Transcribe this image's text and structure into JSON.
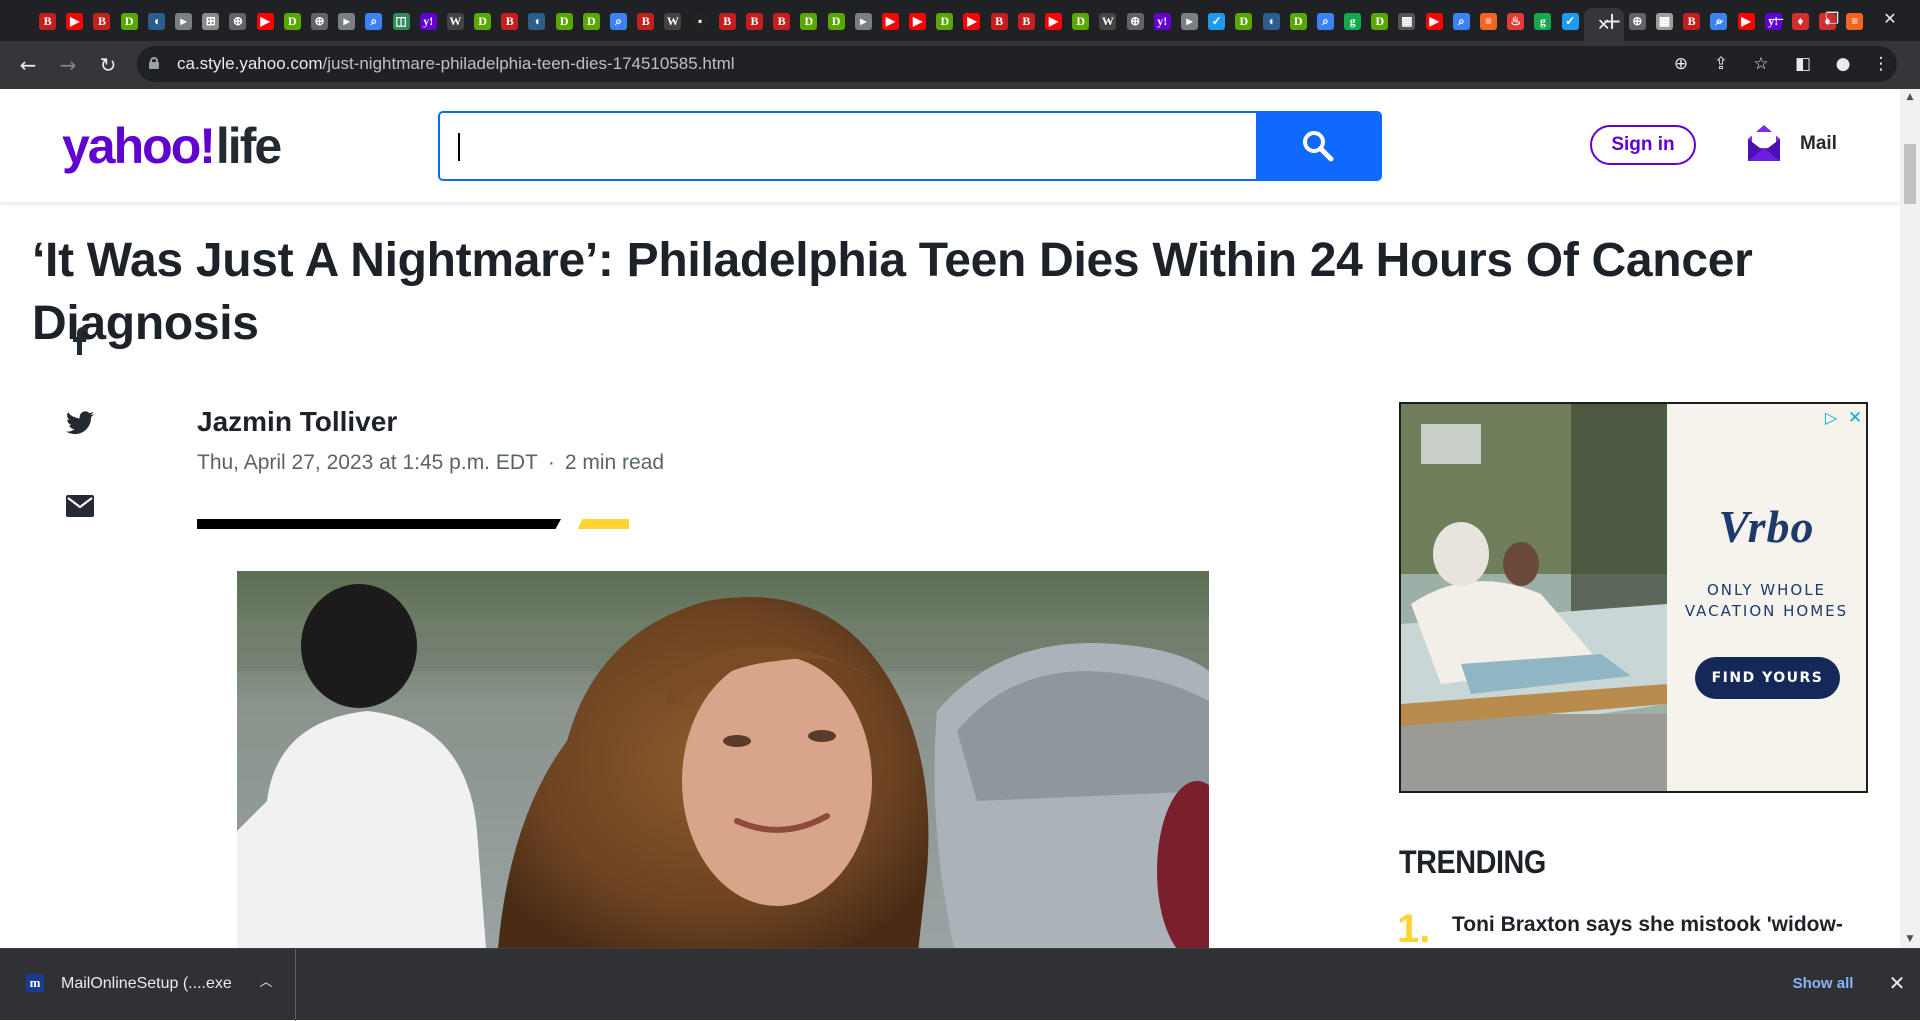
{
  "browser": {
    "tabs": [
      {
        "icon": "B",
        "color": "#c41e1e"
      },
      {
        "icon": "▶",
        "color": "#ff0000"
      },
      {
        "icon": "B",
        "color": "#c41e1e"
      },
      {
        "icon": "D",
        "color": "#5aa700"
      },
      {
        "icon": "◖",
        "color": "#2d5d8a"
      },
      {
        "icon": "▸",
        "color": "#7a7f86"
      },
      {
        "icon": "⊞",
        "color": "#8b8b8b"
      },
      {
        "icon": "⊕",
        "color": "#606368"
      },
      {
        "icon": "▶",
        "color": "#ff0000"
      },
      {
        "icon": "D",
        "color": "#5aa700"
      },
      {
        "icon": "⊕",
        "color": "#606368"
      },
      {
        "icon": "▸",
        "color": "#7a7f86"
      },
      {
        "icon": "⌕",
        "color": "#3b82f6"
      },
      {
        "icon": "◫",
        "color": "#2e8b57"
      },
      {
        "icon": "y!",
        "color": "#6001d2"
      },
      {
        "icon": "W",
        "color": "#444"
      },
      {
        "icon": "D",
        "color": "#5aa700"
      },
      {
        "icon": "B",
        "color": "#c41e1e"
      },
      {
        "icon": "◖",
        "color": "#2d5d8a"
      },
      {
        "icon": "D",
        "color": "#5aa700"
      },
      {
        "icon": "D",
        "color": "#5aa700"
      },
      {
        "icon": "⌕",
        "color": "#3b82f6"
      },
      {
        "icon": "B",
        "color": "#c41e1e"
      },
      {
        "icon": "W",
        "color": "#444"
      },
      {
        "icon": "▪",
        "color": "#222"
      },
      {
        "icon": "B",
        "color": "#c41e1e"
      },
      {
        "icon": "B",
        "color": "#c41e1e"
      },
      {
        "icon": "B",
        "color": "#c41e1e"
      },
      {
        "icon": "D",
        "color": "#5aa700"
      },
      {
        "icon": "D",
        "color": "#5aa700"
      },
      {
        "icon": "▸",
        "color": "#7a7f86"
      },
      {
        "icon": "▶",
        "color": "#ff0000"
      },
      {
        "icon": "▶",
        "color": "#ff0000"
      },
      {
        "icon": "D",
        "color": "#5aa700"
      },
      {
        "icon": "▶",
        "color": "#ff0000"
      },
      {
        "icon": "B",
        "color": "#c41e1e"
      },
      {
        "icon": "B",
        "color": "#c41e1e"
      },
      {
        "icon": "▶",
        "color": "#ff0000"
      },
      {
        "icon": "D",
        "color": "#5aa700"
      },
      {
        "icon": "W",
        "color": "#444"
      },
      {
        "icon": "⊕",
        "color": "#606368"
      },
      {
        "icon": "y!",
        "color": "#6001d2"
      },
      {
        "icon": "▸",
        "color": "#7a7f86"
      },
      {
        "icon": "✓",
        "color": "#1d9bf0"
      },
      {
        "icon": "D",
        "color": "#5aa700"
      },
      {
        "icon": "◖",
        "color": "#2d5d8a"
      },
      {
        "icon": "D",
        "color": "#5aa700"
      },
      {
        "icon": "⌕",
        "color": "#3b82f6"
      },
      {
        "icon": "g",
        "color": "#13a94c"
      },
      {
        "icon": "D",
        "color": "#5aa700"
      },
      {
        "icon": "▦",
        "color": "#555"
      },
      {
        "icon": "▶",
        "color": "#ff0000"
      },
      {
        "icon": "⌕",
        "color": "#3b82f6"
      },
      {
        "icon": "≡",
        "color": "#f26522"
      },
      {
        "icon": "♨",
        "color": "#e53935"
      },
      {
        "icon": "g",
        "color": "#13a94c"
      },
      {
        "icon": "✓",
        "color": "#1d9bf0"
      },
      {
        "icon": "✕",
        "color": "#35363a",
        "active": true
      },
      {
        "icon": "⊕",
        "color": "#606368"
      },
      {
        "icon": "▦",
        "color": "#9e9e9e"
      },
      {
        "icon": "B",
        "color": "#c41e1e"
      },
      {
        "icon": "⌕",
        "color": "#3b82f6"
      },
      {
        "icon": "▶",
        "color": "#ff0000"
      },
      {
        "icon": "y!",
        "color": "#6001d2"
      },
      {
        "icon": "♦",
        "color": "#d32f2f"
      },
      {
        "icon": "♦",
        "color": "#d32f2f"
      },
      {
        "icon": "≡",
        "color": "#f26522"
      }
    ],
    "new_tab": "+",
    "url_host": "ca.style.yahoo.com",
    "url_path": "/just-nightmare-philadelphia-teen-dies-174510585.html"
  },
  "header": {
    "logo_main": "yahoo!",
    "logo_section": "life",
    "search_value": "",
    "signin_label": "Sign in",
    "mail_label": "Mail"
  },
  "article": {
    "headline": "‘It Was Just A Nightmare’: Philadelphia Teen Dies Within 24 Hours Of Cancer Diagnosis",
    "author": "Jazmin Tolliver",
    "date": "Thu, April 27, 2023 at 1:45 p.m. EDT",
    "separator": "·",
    "read_time": "2 min read"
  },
  "ad": {
    "brand": "Vrbo",
    "tagline_1": "ONLY WHOLE",
    "tagline_2": "VACATION HOMES",
    "cta": "FIND YOURS",
    "adchoices_icon": "▷",
    "close_icon": "✕"
  },
  "trending": {
    "heading": "TRENDING",
    "items": [
      {
        "rank": "1.",
        "title": "Toni Braxton says she mistook 'widow-"
      }
    ]
  },
  "downloads": {
    "file_name": "MailOnlineSetup (....exe",
    "file_icon": "m",
    "show_all": "Show all"
  },
  "colors": {
    "yahoo_purple": "#6001d2",
    "search_blue": "#0f69ff",
    "accent_yellow": "#ffd331",
    "text_dark": "#1d2228"
  }
}
